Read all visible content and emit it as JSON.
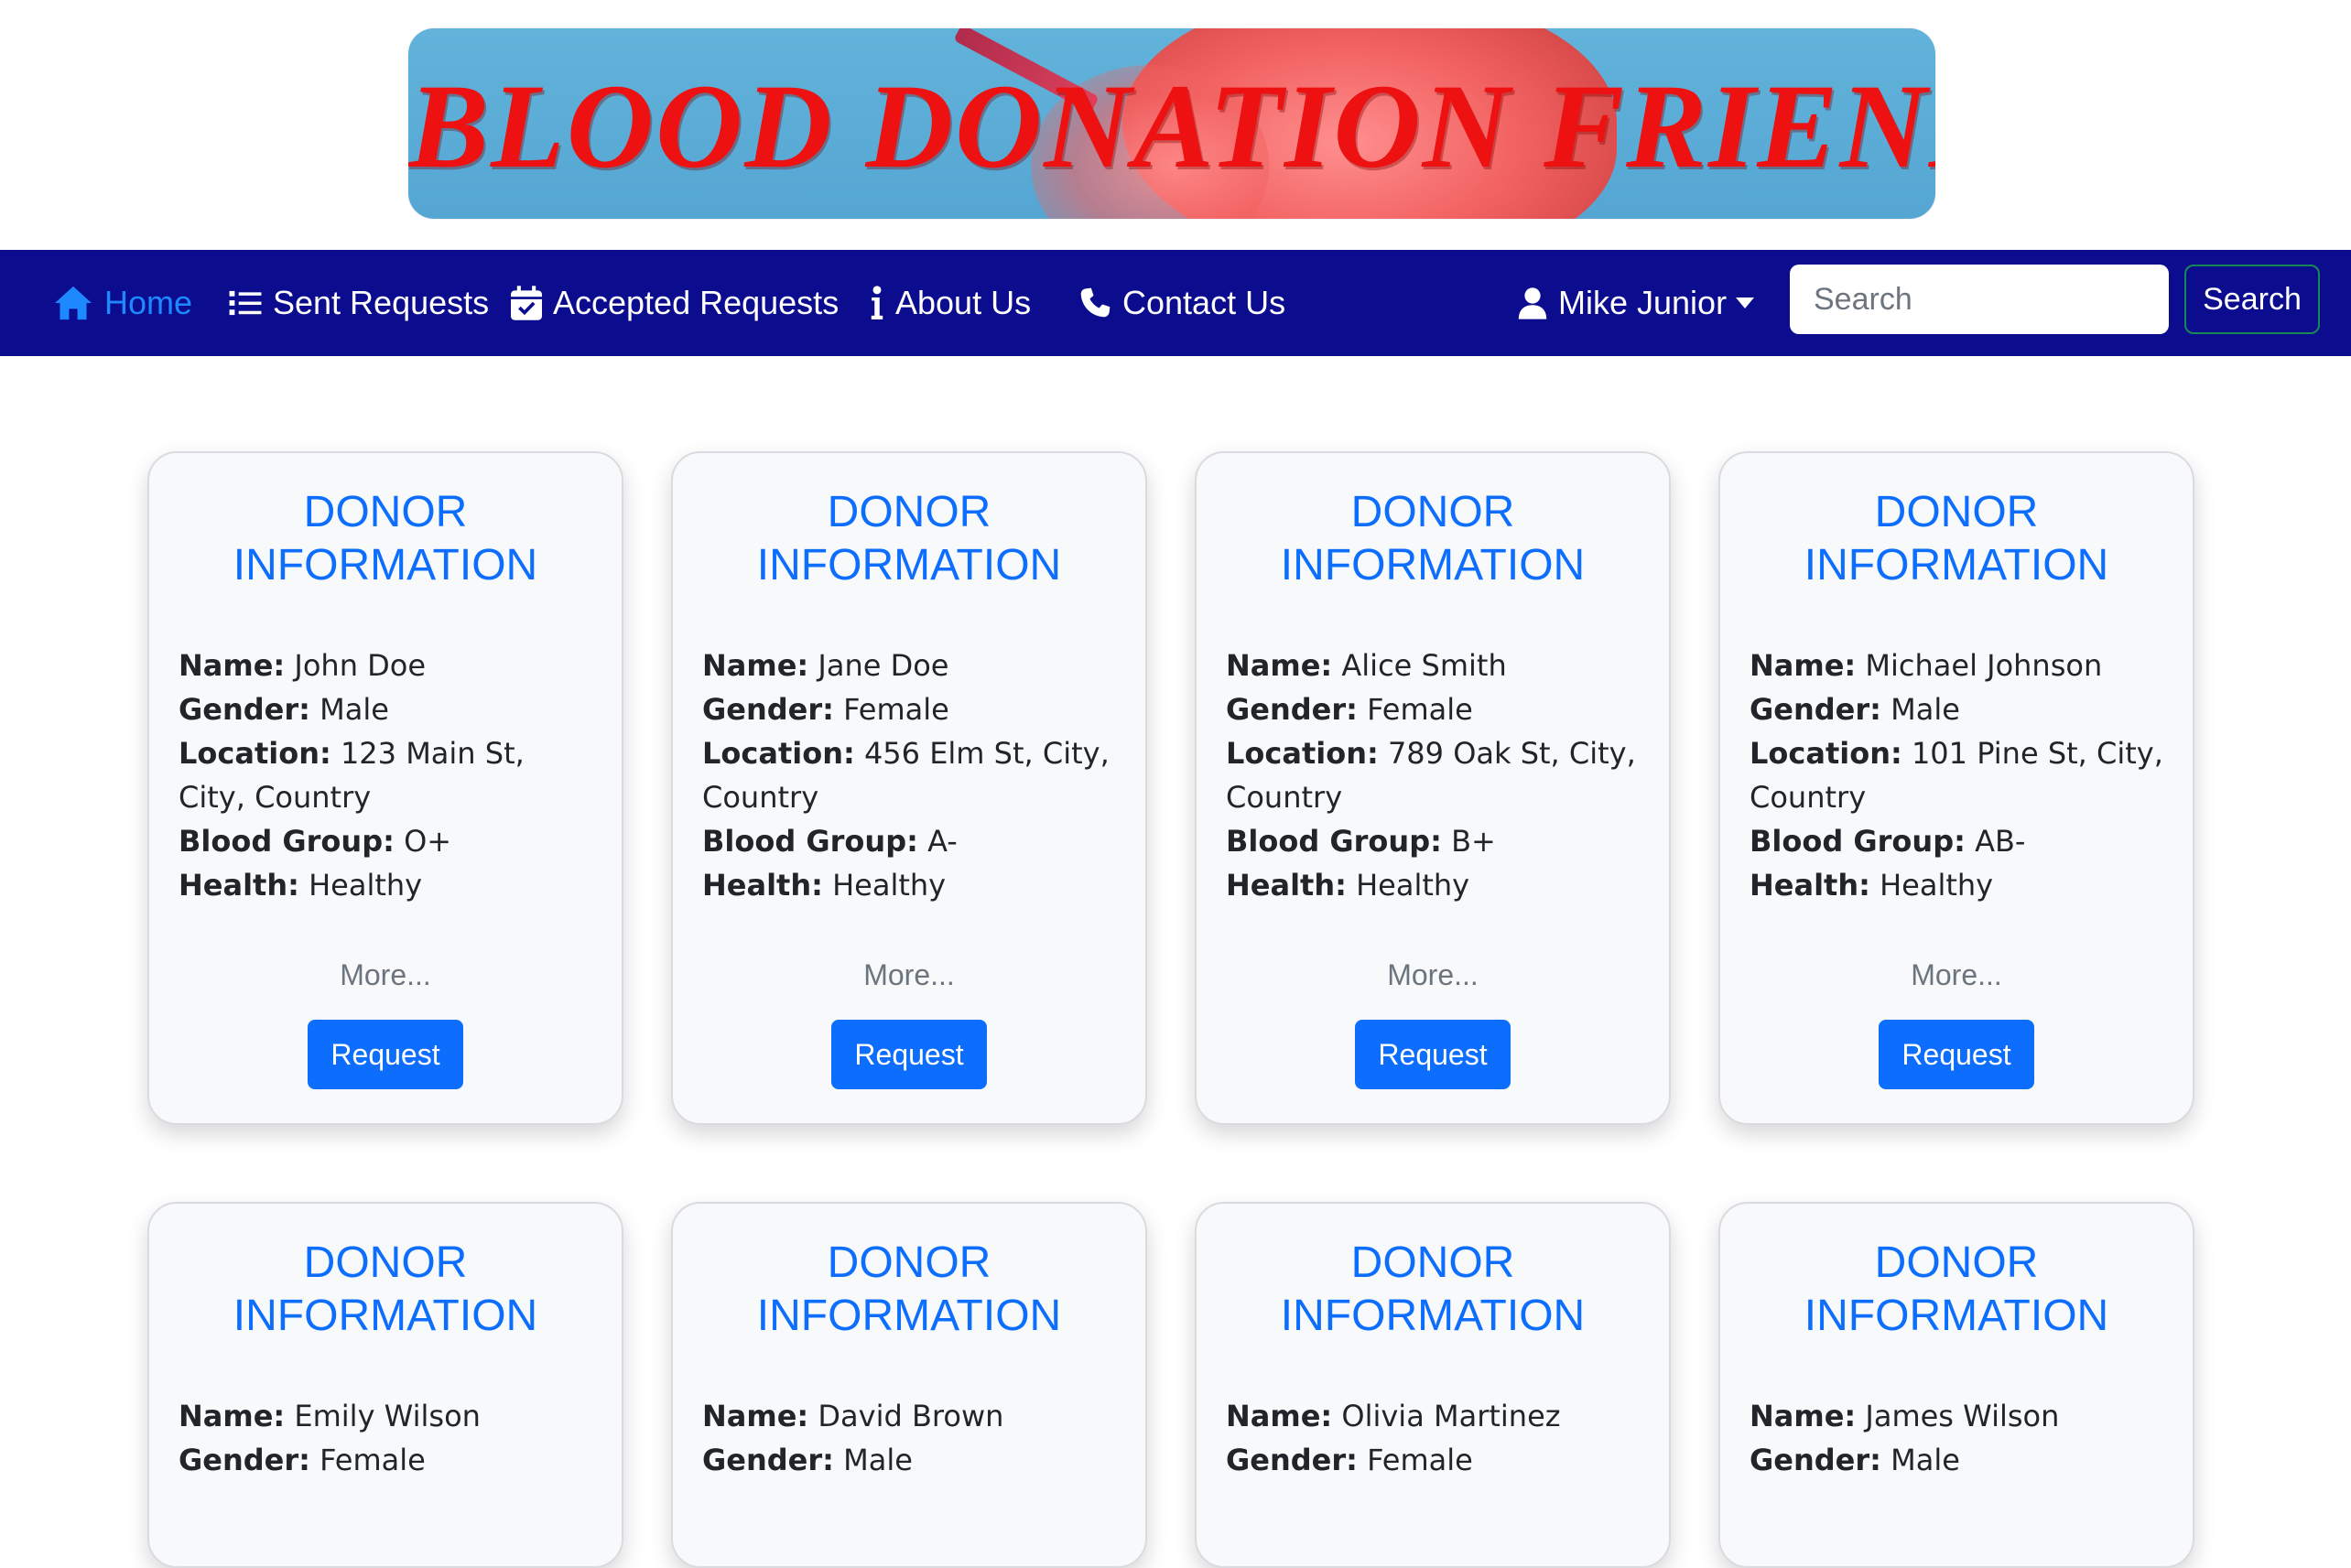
{
  "banner": {
    "title": "BLOOD DONATION FRIEND"
  },
  "nav": {
    "items": [
      {
        "label": "Home",
        "icon": "home-icon",
        "active": true
      },
      {
        "label": "Sent Requests",
        "icon": "list-icon"
      },
      {
        "label": "Accepted Requests",
        "icon": "calendar-check-icon"
      },
      {
        "label": "About Us",
        "icon": "info-icon"
      },
      {
        "label": "Contact Us",
        "icon": "phone-icon"
      }
    ],
    "user": {
      "name": "Mike Junior",
      "icon": "user-icon"
    },
    "search": {
      "placeholder": "Search",
      "button_label": "Search"
    }
  },
  "colors": {
    "navbar": "#0c0c8f",
    "accent": "#0d6efd",
    "active_link": "#1e88ff",
    "search_border": "#198754",
    "banner_title": "#ee1111"
  },
  "labels": {
    "card_title_line1": "DONOR",
    "card_title_line2": "INFORMATION",
    "name": "Name:",
    "gender": "Gender:",
    "location": "Location:",
    "blood_group": "Blood Group:",
    "health": "Health:",
    "more": "More...",
    "request": "Request"
  },
  "donors": [
    {
      "name": "John Doe",
      "gender": "Male",
      "location": "123 Main St, City, Country",
      "blood_group": "O+",
      "health": "Healthy"
    },
    {
      "name": "Jane Doe",
      "gender": "Female",
      "location": "456 Elm St, City, Country",
      "blood_group": "A-",
      "health": "Healthy"
    },
    {
      "name": "Alice Smith",
      "gender": "Female",
      "location": "789 Oak St, City, Country",
      "blood_group": "B+",
      "health": "Healthy"
    },
    {
      "name": "Michael Johnson",
      "gender": "Male",
      "location": "101 Pine St, City, Country",
      "blood_group": "AB-",
      "health": "Healthy"
    },
    {
      "name": "Emily Wilson",
      "gender": "Female"
    },
    {
      "name": "David Brown",
      "gender": "Male"
    },
    {
      "name": "Olivia Martinez",
      "gender": "Female"
    },
    {
      "name": "James Wilson",
      "gender": "Male"
    }
  ]
}
